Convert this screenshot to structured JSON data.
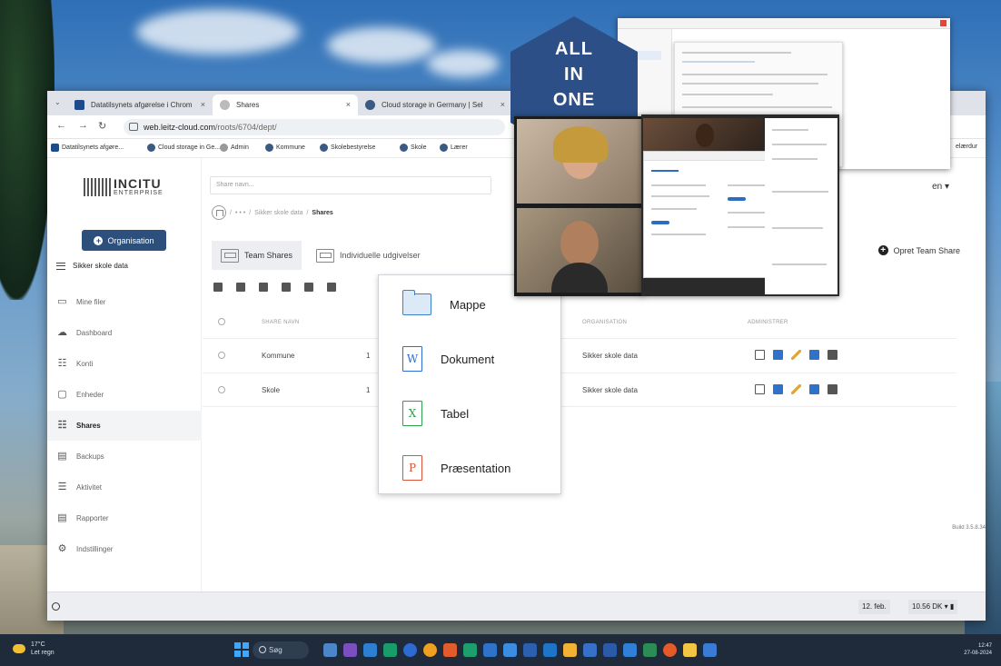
{
  "browser": {
    "tabs": [
      {
        "label": "Datatilsynets afgørelse i Chrom",
        "close": "×"
      },
      {
        "label": "Shares",
        "close": "×"
      },
      {
        "label": "Cloud storage in Germany | Sel",
        "close": "×"
      }
    ],
    "url_host": "web.leitz-cloud.com",
    "url_path": "/roots/6704/dept/",
    "bookmarks": [
      "Datatilsynets afgøre...",
      "Cloud storage in Ge...",
      "Admin",
      "Kommune",
      "Skolebestyrelse",
      "Skole",
      "Lærer"
    ],
    "bookmark_right": "elærdur"
  },
  "badge": {
    "line1": "ALL",
    "line2": "IN",
    "line3": "ONE"
  },
  "sidebar": {
    "logo_main": "INCITU",
    "logo_sub": "ENTERPRISE",
    "org_button": "Organisation",
    "section": "Sikker skole data",
    "items": [
      {
        "label": "Mine filer",
        "icon": "folder-icon"
      },
      {
        "label": "Dashboard",
        "icon": "dashboard-icon"
      },
      {
        "label": "Konti",
        "icon": "users-icon"
      },
      {
        "label": "Enheder",
        "icon": "monitor-icon"
      },
      {
        "label": "Shares",
        "icon": "shares-icon",
        "active": true
      },
      {
        "label": "Backups",
        "icon": "backup-icon"
      },
      {
        "label": "Aktivitet",
        "icon": "activity-icon"
      },
      {
        "label": "Rapporter",
        "icon": "report-icon"
      },
      {
        "label": "Indstillinger",
        "icon": "settings-icon"
      }
    ]
  },
  "main": {
    "search_placeholder": "Share navn...",
    "breadcrumb": [
      "• • •",
      "Sikker skole data",
      "Shares"
    ],
    "tabs": [
      "Team Shares",
      "Individuelle udgivelser"
    ],
    "create_button": "Opret Team Share",
    "lang_suffix": "en ▾",
    "columns": {
      "name": "SHARE NAVN",
      "org": "ORGANISATION",
      "admin": "ADMINISTRER"
    },
    "rows": [
      {
        "name": "Kommune",
        "num": "1",
        "org": "Sikker skole data"
      },
      {
        "name": "Skole",
        "num": "1",
        "org": "Sikker skole data"
      }
    ],
    "build": "Build 3.5.8.34"
  },
  "menu": {
    "items": [
      {
        "label": "Mappe",
        "icon": "folder-icon"
      },
      {
        "label": "Dokument",
        "icon": "document-icon",
        "glyph": "W",
        "color": "#2e6bd1"
      },
      {
        "label": "Tabel",
        "icon": "spreadsheet-icon",
        "glyph": "X",
        "color": "#2f9e4e"
      },
      {
        "label": "Præsentation",
        "icon": "presentation-icon",
        "glyph": "P",
        "color": "#d9543b"
      }
    ]
  },
  "statusbar": {
    "date": "12. feb.",
    "time": "10.56 DK ▾ ▮"
  },
  "taskbar": {
    "weather_temp": "17°C",
    "weather_desc": "Let regn",
    "search": "Søg",
    "clock_time": "12:47",
    "clock_date": "27-08-2024"
  },
  "colors": {
    "primary": "#2c4f7c",
    "badge": "#2b4f86",
    "taskbar": "#1f2b3a"
  }
}
